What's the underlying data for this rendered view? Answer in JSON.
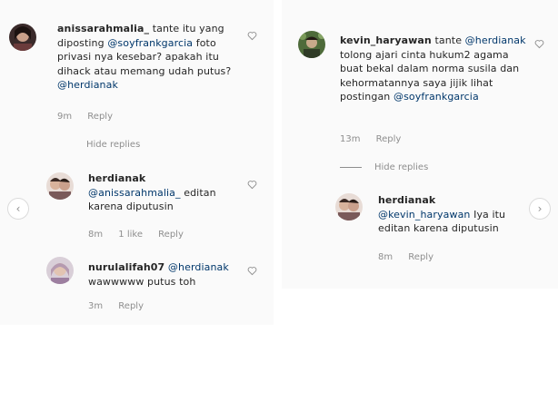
{
  "left": {
    "comment1": {
      "username": "anissarahmalia_",
      "text_a": "tante itu yang diposting",
      "mention_a": "@soyfrankgarcia",
      "text_b": "foto privasi nya kesebar? apakah itu dihack atau memang udah putus?",
      "mention_b": "@herdianak",
      "time": "9m",
      "reply": "Reply"
    },
    "hide_replies": "Hide replies",
    "comment2": {
      "username": "herdianak",
      "mention": "@anissarahmalia_",
      "text": "editan karena diputusin",
      "time": "8m",
      "likes": "1 like",
      "reply": "Reply"
    },
    "comment3": {
      "username": "nurulalifah07",
      "mention": "@herdianak",
      "text": "wawwwww putus toh",
      "time": "3m",
      "reply": "Reply"
    }
  },
  "right": {
    "comment1": {
      "username": "kevin_haryawan",
      "text_a": "tante",
      "mention_a": "@herdianak",
      "text_b": "tolong ajari cinta hukum2 agama buat bekal dalam norma susila dan kehormatannya saya jijik lihat postingan",
      "mention_b": "@soyfrankgarcia",
      "time": "13m",
      "reply": "Reply"
    },
    "hide_replies": "Hide replies",
    "comment2": {
      "username": "herdianak",
      "mention": "@kevin_haryawan",
      "text": "Iya itu editan karena diputusin",
      "time": "8m",
      "reply": "Reply"
    }
  },
  "nav": {
    "left_arrow": "‹",
    "right_arrow": "›"
  },
  "colors": {
    "panel_bg": "#fafafa",
    "mention": "#00376b",
    "meta": "#8e8e8e"
  }
}
